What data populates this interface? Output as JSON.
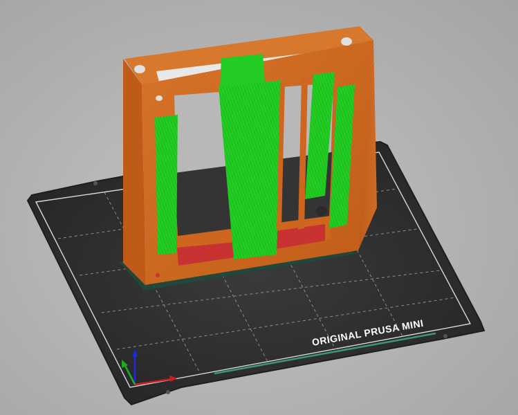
{
  "viewport": {
    "background_color": "#b4b4b4",
    "bed": {
      "label": "ORIGINAL PRUSA MINI",
      "surface_color": "#2e2e2e",
      "grid_color": "#9a9a9a",
      "label_color": "#ffffff"
    },
    "axes": {
      "x_color": "#cc2020",
      "y_color": "#22aa22",
      "z_color": "#1a2ae0"
    },
    "model": {
      "frame_color": "#d2691e",
      "support_color": "#22cc22",
      "bridge_color": "#c83232"
    }
  }
}
